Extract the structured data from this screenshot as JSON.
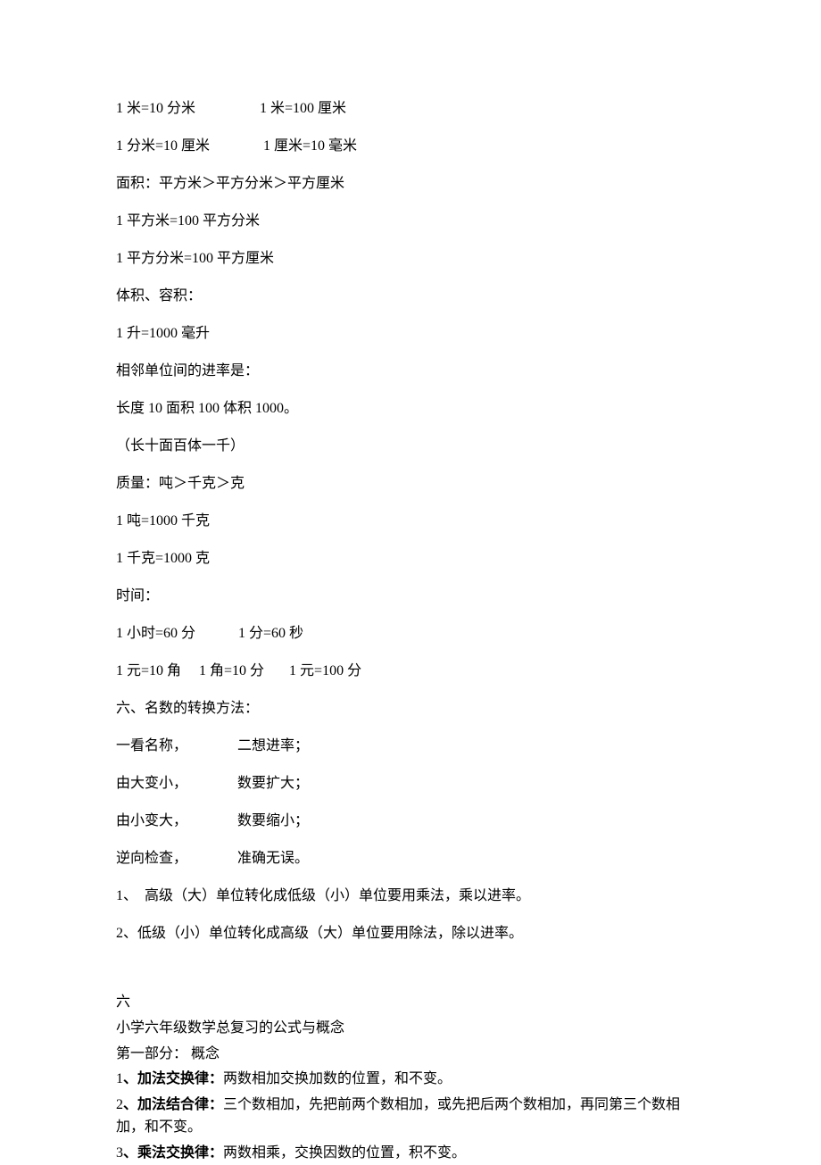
{
  "lines": {
    "l1": "1 米=10 分米                  1 米=100 厘米",
    "l2": "1 分米=10 厘米               1 厘米=10 毫米",
    "l3": "面积：平方米＞平方分米＞平方厘米",
    "l4": "1 平方米=100 平方分米",
    "l5": "1 平方分米=100 平方厘米",
    "l6": "体积、容积：",
    "l7": "1 升=1000 毫升",
    "l8": "相邻单位间的进率是：",
    "l9": "长度 10 面积 100 体积 1000。",
    "l10": "（长十面百体一千）",
    "l11": "质量：吨＞千克＞克",
    "l12": "1 吨=1000 千克",
    "l13": "1 千克=1000 克",
    "l14": "时间：",
    "l15": "1 小时=60 分            1 分=60 秒",
    "l16": "1 元=10 角     1 角=10 分       1 元=100 分",
    "l17": "六、名数的转换方法：",
    "l18": "一看名称，              二想进率；",
    "l19": "由大变小，              数要扩大；",
    "l20": "由小变大，              数要缩小；",
    "l21": "逆向检查，              准确无误。",
    "l22": "1、  高级（大）单位转化成低级（小）单位要用乘法，乘以进率。",
    "l23": "2、低级（小）单位转化成高级（大）单位要用除法，除以进率。"
  },
  "section2": {
    "h1": "六",
    "h2": "小学六年级数学总复习的公式与概念",
    "h3": "第一部分：   概念",
    "p1_num": "1",
    "p1_label": "、加法交换律：",
    "p1_text": "两数相加交换加数的位置，和不变。",
    "p2_num": "2",
    "p2_label": "、加法结合律：",
    "p2_text": "三个数相加，先把前两个数相加，或先把后两个数相加，再同第三个数相加，和不变。",
    "p3_num": "3",
    "p3_label": "、乘法交换律：",
    "p3_text": "两数相乘，交换因数的位置，积不变。"
  }
}
